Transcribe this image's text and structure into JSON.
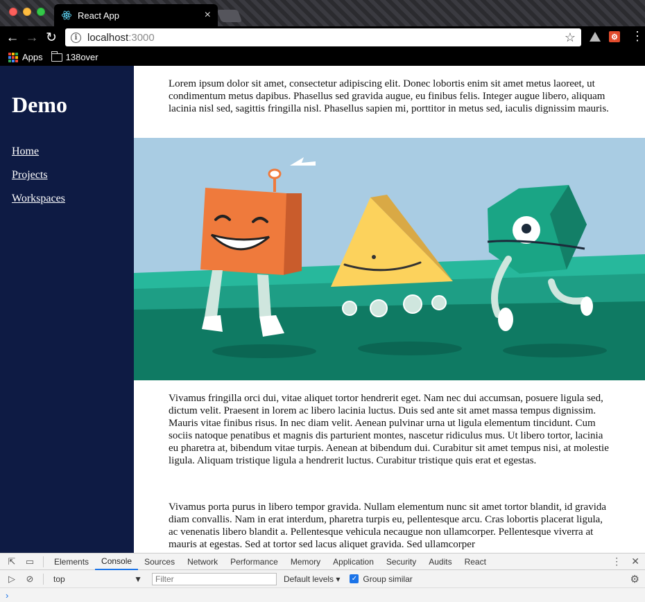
{
  "browser": {
    "tab_title": "React App",
    "tab_close": "×",
    "url_host": "localhost",
    "url_port": ":3000",
    "bookmarks": [
      {
        "label": "Apps"
      },
      {
        "label": "138over"
      }
    ]
  },
  "sidebar": {
    "title": "Demo",
    "links": [
      {
        "label": "Home"
      },
      {
        "label": "Projects"
      },
      {
        "label": "Workspaces"
      }
    ]
  },
  "content": {
    "paragraph1": "Lorem ipsum dolor sit amet, consectetur adipiscing elit. Donec lobortis enim sit amet metus laoreet, ut condimentum metus dapibus. Phasellus sed gravida augue, eu finibus felis. Integer augue libero, aliquam lacinia nisl sed, sagittis fringilla nisl. Phasellus sapien mi, porttitor in metus sed, iaculis dignissim mauris.",
    "paragraph2": "Vivamus fringilla orci dui, vitae aliquet tortor hendrerit eget. Nam nec dui accumsan, posuere ligula sed, dictum velit. Praesent in lorem ac libero lacinia luctus. Duis sed ante sit amet massa tempus dignissim. Mauris vitae finibus risus. In nec diam velit. Aenean pulvinar urna ut ligula elementum tincidunt. Cum sociis natoque penatibus et magnis dis parturient montes, nascetur ridiculus mus. Ut libero tortor, lacinia eu pharetra at, bibendum vitae turpis. Aenean at bibendum dui. Curabitur sit amet tempus nisi, at molestie ligula. Aliquam tristique ligula a hendrerit luctus. Curabitur tristique quis erat et egestas.",
    "paragraph3": "Vivamus porta purus in libero tempor gravida. Nullam elementum nunc sit amet tortor blandit, id gravida diam convallis. Nam in erat interdum, pharetra turpis eu, pellentesque arcu. Cras lobortis placerat ligula, ac venenatis libero blandit a. Pellentesque vehicula necaugue non ullamcorper. Pellentesque viverra at mauris at egestas. Sed at tortor sed lacus aliquet gravida. Sed ullamcorper"
  },
  "devtools": {
    "tabs": [
      {
        "label": "Elements"
      },
      {
        "label": "Console"
      },
      {
        "label": "Sources"
      },
      {
        "label": "Network"
      },
      {
        "label": "Performance"
      },
      {
        "label": "Memory"
      },
      {
        "label": "Application"
      },
      {
        "label": "Security"
      },
      {
        "label": "Audits"
      },
      {
        "label": "React"
      }
    ],
    "active_tab": "Console",
    "context": "top",
    "filter_placeholder": "Filter",
    "levels": "Default levels ▾",
    "group_similar": "Group similar",
    "prompt": "›"
  },
  "colors": {
    "sidebar_bg": "#0e1b44",
    "sky": "#a9cce3",
    "field_light": "#27b89c",
    "field_dark": "#0f7a63",
    "accent": "#1a73e8"
  }
}
